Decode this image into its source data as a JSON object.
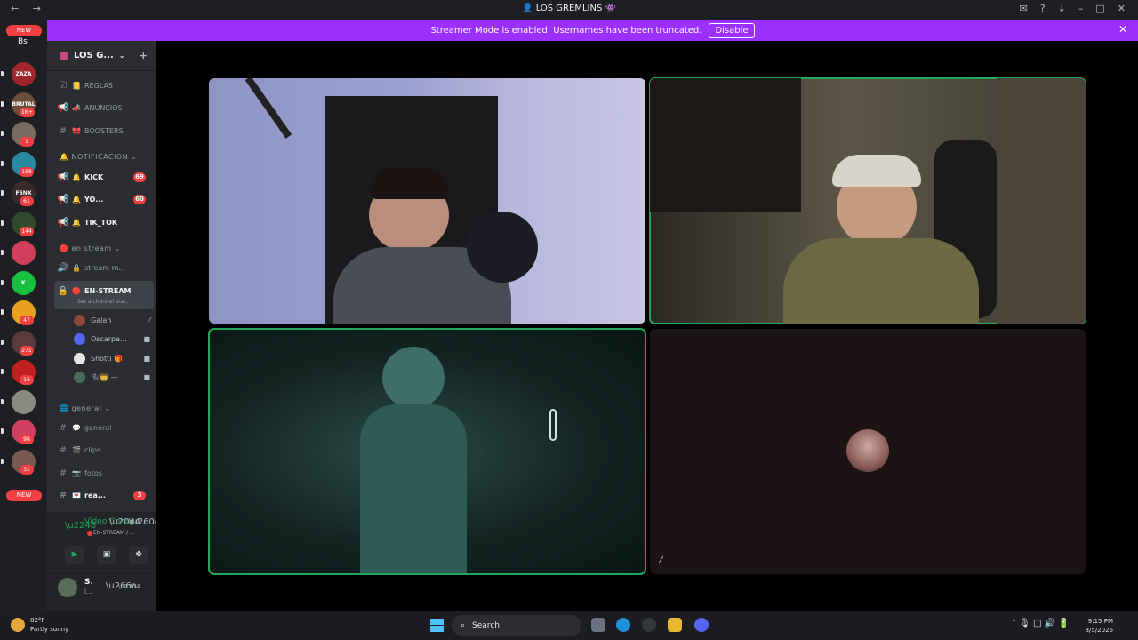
{
  "titlebar": {
    "nav_label": "← →",
    "window_title": "👤 LOS GREMLINS 👾",
    "right_icons": [
      "inbox-icon",
      "help-icon",
      "download-icon",
      "minimize-icon",
      "maximize-icon",
      "close-icon"
    ],
    "right_glyphs": [
      "✉",
      "?",
      "↓",
      "–",
      "□",
      "✕"
    ]
  },
  "banner": {
    "text": "Streamer Mode is enabled. Usernames have been truncated.",
    "button": "Disable",
    "close": "✕"
  },
  "guilds": {
    "top_label": "NEW",
    "top_tag": "Bs",
    "bottom_label": "NEW",
    "items": [
      {
        "color": "#a3252c",
        "label": "ZAZA",
        "badge": ""
      },
      {
        "color": "#6b4d3a",
        "label": "BRUTAL",
        "badge": "1K+"
      },
      {
        "color": "#7a6a60",
        "label": "",
        "badge": "1"
      },
      {
        "color": "#2a8aa0",
        "label": "",
        "badge": "198"
      },
      {
        "color": "#3a2a2a",
        "label": "F5NX",
        "badge": "61"
      },
      {
        "color": "#2f4a2a",
        "label": "",
        "badge": "144"
      },
      {
        "color": "#d0405a",
        "label": "",
        "badge": ""
      },
      {
        "color": "#18c040",
        "label": "K",
        "badge": ""
      },
      {
        "color": "#e8a020",
        "label": "",
        "badge": "47"
      },
      {
        "color": "#5a3a3a",
        "label": "",
        "badge": "271"
      },
      {
        "color": "#c02020",
        "label": "",
        "badge": "16"
      },
      {
        "color": "#8a8a80",
        "label": "",
        "badge": ""
      },
      {
        "color": "#d04060",
        "label": "",
        "badge": "98"
      },
      {
        "color": "#7a5a50",
        "label": "",
        "badge": "31"
      }
    ]
  },
  "server": {
    "name": "LOS G...",
    "caret": "⌄",
    "invite_icon": "+"
  },
  "channels": {
    "top": [
      {
        "sym": "☑",
        "emo": "📒",
        "name": "REGLAS"
      },
      {
        "sym": "📢",
        "emo": "📣",
        "name": "ANUNCIOS"
      },
      {
        "sym": "#",
        "emo": "🎀",
        "name": "BOOSTERS"
      }
    ],
    "notif_category": "🔔 NOTIFICACION ⌄",
    "notif": [
      {
        "sym": "📢",
        "emo": "🔔",
        "name": "KICK",
        "badge": "69"
      },
      {
        "sym": "📢",
        "emo": "🔔",
        "name": "YO...",
        "badge": "60"
      },
      {
        "sym": "📢",
        "emo": "🔔",
        "name": "TIK_TOK",
        "badge": ""
      }
    ],
    "stream_category": "🔴 en stream ⌄",
    "stream": [
      {
        "sym": "🔊",
        "emo": "🔒",
        "name": "stream m..."
      },
      {
        "sym": "🔒",
        "emo": "🔴",
        "name": "EN-STREAM"
      }
    ],
    "status_hint": "Set a channel sta...",
    "members": [
      {
        "name": "Galan",
        "color": "#8a4a3a",
        "icon": "⁄"
      },
      {
        "name": "Oscarpa...",
        "color": "#5865f2",
        "icon": "■"
      },
      {
        "name": "Shotti 🎁",
        "color": "#e8e8e8",
        "icon": "■"
      },
      {
        "name": "🐈‍⬛👑 —",
        "color": "#4a6a5a",
        "icon": "■"
      }
    ],
    "general_category": "🌐 general ⌄",
    "general": [
      {
        "sym": "#",
        "emo": "💬",
        "name": "general",
        "badge": ""
      },
      {
        "sym": "#",
        "emo": "🎬",
        "name": "clips",
        "badge": ""
      },
      {
        "sym": "#",
        "emo": "📷",
        "name": "fotos",
        "badge": ""
      },
      {
        "sym": "#",
        "emo": "💌",
        "name": "rea...",
        "badge": "3"
      }
    ]
  },
  "voice": {
    "status": "Video Connec...",
    "channel": "EN-STREAM / ...",
    "buttons": [
      "▶",
      "▣",
      "❖",
      "✦"
    ]
  },
  "user": {
    "name": "S.",
    "sub": "l..."
  },
  "call": {
    "mute_icon": "⁄"
  },
  "taskbar": {
    "temp": "82°F",
    "condition": "Partly sunny",
    "search": "Search",
    "search_icon": "⌕",
    "tray": "˄  🎙  □  🔊  🔋",
    "time": "9:15 PM",
    "date": "8/5/2026"
  }
}
